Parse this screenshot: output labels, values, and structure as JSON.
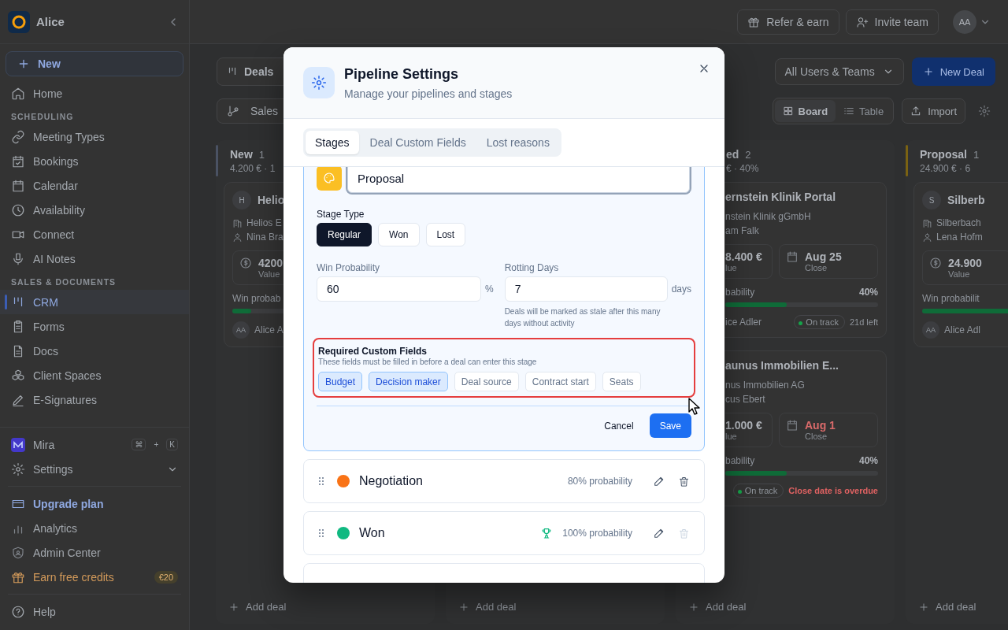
{
  "sidebar": {
    "workspace": "Alice",
    "new_button": "New",
    "nav": [
      {
        "kind": "item",
        "label": "Home",
        "selected": false
      },
      {
        "kind": "section",
        "label": "SCHEDULING"
      },
      {
        "kind": "item",
        "label": "Meeting Types",
        "selected": false
      },
      {
        "kind": "item",
        "label": "Bookings",
        "selected": false
      },
      {
        "kind": "item",
        "label": "Calendar",
        "selected": false
      },
      {
        "kind": "item",
        "label": "Availability",
        "selected": false
      },
      {
        "kind": "item",
        "label": "Connect",
        "selected": false
      },
      {
        "kind": "item",
        "label": "AI Notes",
        "selected": false
      },
      {
        "kind": "section",
        "label": "SALES & DOCUMENTS"
      },
      {
        "kind": "item",
        "label": "CRM",
        "selected": true
      },
      {
        "kind": "item",
        "label": "Forms",
        "selected": false
      },
      {
        "kind": "item",
        "label": "Docs",
        "selected": false
      },
      {
        "kind": "item",
        "label": "Client Spaces",
        "selected": false
      },
      {
        "kind": "item",
        "label": "E-Signatures",
        "selected": false
      }
    ],
    "assistant": {
      "label": "Mira",
      "keys": [
        "⌘",
        "K"
      ],
      "joiner": "+"
    },
    "settings": {
      "label": "Settings",
      "expanded": false
    },
    "links": [
      {
        "kind": "upgrade",
        "label": "Upgrade plan"
      },
      {
        "kind": "plain",
        "label": "Analytics"
      },
      {
        "kind": "plain",
        "label": "Admin Center"
      },
      {
        "kind": "referral",
        "label": "Earn free credits",
        "badge": "€20"
      }
    ],
    "help": "Help"
  },
  "topbar": {
    "buttons": [
      "Refer & earn",
      "Invite team"
    ],
    "avatar": "AA"
  },
  "toolbar": {
    "title": "Deals",
    "pipeline": "Sales",
    "filter": "All Users & Teams",
    "new_deal": "New Deal",
    "views": [
      {
        "label": "Board",
        "selected": true
      },
      {
        "label": "Table",
        "selected": false
      }
    ],
    "import": "Import"
  },
  "board": {
    "columns": [
      {
        "name": "New",
        "count": "1",
        "summary": "4.200 € · 1",
        "color": "#4a5263",
        "add_deal": "Add deal",
        "cards": [
          {
            "avatar": "H",
            "title": "Helio",
            "company": "Helios E",
            "contact": "Nina Bra",
            "value": "4200",
            "value_label": "Value",
            "probability_label": "Win probab",
            "level": 0.1,
            "owner_initials": "AA",
            "owner": "Alice A"
          }
        ]
      },
      {
        "add_deal": "Add deal"
      },
      {
        "name": "ed",
        "count": "2",
        "summary": "€ · 40%",
        "add_deal": "Add deal",
        "cards": [
          {
            "title": "ernstein Klinik Portal",
            "company": "nstein Klinik gGmbH",
            "contact": "am Falk",
            "value": "8.400 €",
            "value_label": "lue",
            "close_date": "Aug 25",
            "close_label": "Close",
            "overdue": false,
            "probability_label": "bability",
            "probability": "40%",
            "level": 0.4,
            "owner": "ice Adler",
            "status": "On track",
            "note": "21d left",
            "note_alert": false
          },
          {
            "title": "aunus Immobilien E...",
            "company": "nus Immobilien AG",
            "contact": "cus Ebert",
            "value": "1.000 €",
            "value_label": "lue",
            "close_date": "Aug 1",
            "close_label": "Close",
            "overdue": true,
            "probability_label": "bability",
            "probability": "40%",
            "level": 0.4,
            "status": "On track",
            "note": "Close date is overdue",
            "note_alert": true
          }
        ]
      },
      {
        "name": "Proposal",
        "count": "1",
        "summary": "24.900 € · 6",
        "color": "#7a6212",
        "add_deal": "Add deal",
        "cards": [
          {
            "avatar": "S",
            "title": "Silberb",
            "company": "Silberbach",
            "contact": "Lena Hofm",
            "value": "24.900",
            "value_label": "Value",
            "probability_label": "Win probabilit",
            "level": 0.6,
            "owner_initials": "AA",
            "owner": "Alice Adl"
          }
        ]
      }
    ]
  },
  "modal": {
    "title": "Pipeline Settings",
    "subtitle": "Manage your pipelines and stages",
    "tabs": [
      {
        "label": "Stages",
        "selected": true
      },
      {
        "label": "Deal Custom Fields",
        "selected": false
      },
      {
        "label": "Lost reasons",
        "selected": false
      }
    ],
    "editor": {
      "name": "Proposal",
      "color": "#fbbf24",
      "type_label": "Stage Type",
      "types": [
        {
          "label": "Regular",
          "selected": true
        },
        {
          "label": "Won",
          "selected": false
        },
        {
          "label": "Lost",
          "selected": false
        }
      ],
      "probability_label": "Win Probability",
      "probability": "60",
      "probability_unit": "%",
      "rotting_label": "Rotting Days",
      "rotting": "7",
      "rotting_unit": "days",
      "rotting_hint": "Deals will be marked as stale after this many days without activity",
      "required": {
        "title": "Required Custom Fields",
        "hint": "These fields must be filled in before a deal can enter this stage",
        "highlighted": true,
        "fields": [
          {
            "label": "Budget",
            "selected": true
          },
          {
            "label": "Decision maker",
            "selected": true
          },
          {
            "label": "Deal source",
            "selected": false
          },
          {
            "label": "Contract start",
            "selected": false
          },
          {
            "label": "Seats",
            "selected": false
          }
        ]
      },
      "cancel": "Cancel",
      "save": "Save"
    },
    "stages": [
      {
        "name": "Negotiation",
        "color": "#f97316",
        "probability": "80% probability",
        "kind": "regular",
        "delete_disabled": false
      },
      {
        "name": "Won",
        "color": "#10b981",
        "probability": "100% probability",
        "kind": "won",
        "delete_disabled": true
      }
    ]
  }
}
